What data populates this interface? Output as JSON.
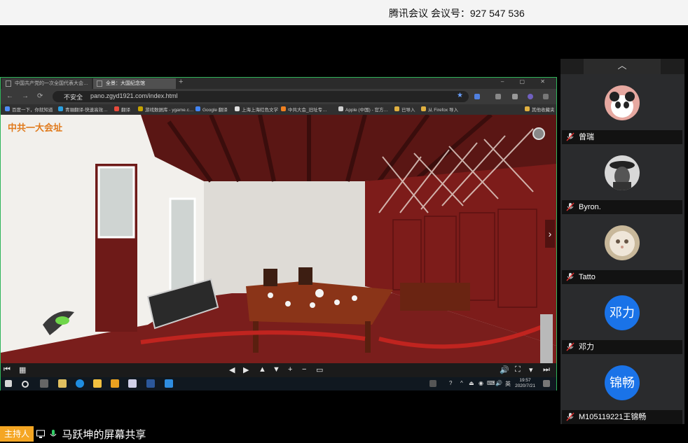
{
  "top_bar": {
    "meeting_info": "腾讯会议 会议号：927 547 536"
  },
  "browser": {
    "tabs": [
      {
        "label": "中国共产党的一次全国代表大会…"
      },
      {
        "label": "全景：大国纪念馆"
      }
    ],
    "new_tab": "+",
    "window_controls": "–  ▢  ✕",
    "nav": {
      "back": "←",
      "forward": "→",
      "reload": "⟳"
    },
    "address": {
      "security": "不安全",
      "url": "pano.zgyd1921.com/index.html",
      "star": "★"
    },
    "bookmarks": [
      {
        "label": "百度一下，你就知道",
        "color": "#4e8cf7"
      },
      {
        "label": "青骊翻译-快速高效…",
        "color": "#2aa0e0"
      },
      {
        "label": "翻译",
        "color": "#e84a3c"
      },
      {
        "label": "游戏数据库 - ygame.c…",
        "color": "#c5a300"
      },
      {
        "label": "Google 翻译",
        "color": "#4285f4"
      },
      {
        "label": "上海上海红色文学",
        "color": "#e0e0e0"
      },
      {
        "label": "中共大会_旧址专…",
        "color": "#f08020"
      },
      {
        "label": "Apple (中国) - 官方…",
        "color": "#cfcfcf"
      },
      {
        "label": "已导入",
        "color": "#e0b040"
      },
      {
        "label": "从 Firefox 导入",
        "color": "#e0b040"
      },
      {
        "label": "其他收藏夹",
        "color": "#e0b040"
      }
    ]
  },
  "scene": {
    "title": "中共一大会址",
    "next": "›"
  },
  "viewer_controls": {
    "left": [
      "⏮",
      "▦"
    ],
    "center": [
      "◀",
      "▶",
      "▲",
      "▼",
      "+",
      "−",
      "▭"
    ],
    "right": [
      "🔊",
      "⛶",
      "▾",
      "⏭"
    ]
  },
  "taskbar": {
    "clock_time": "19:57",
    "clock_date": "2020/7/21",
    "tray": [
      "?",
      "^",
      "⏏",
      "◉",
      "⌨",
      "🔊",
      "英"
    ]
  },
  "participants_panel": {
    "collapse": "︿",
    "participants": [
      {
        "name": "曾瑞",
        "avatar_type": "photo-panda",
        "avatar_text": ""
      },
      {
        "name": "Byron.",
        "avatar_type": "photo-man",
        "avatar_text": ""
      },
      {
        "name": "Tatto",
        "avatar_type": "photo-cat",
        "avatar_text": ""
      },
      {
        "name": "邓力",
        "avatar_type": "text",
        "avatar_text": "邓力"
      },
      {
        "name": "M105119221王锦畅",
        "avatar_type": "text",
        "avatar_text": "锦畅"
      }
    ]
  },
  "bottom": {
    "host_badge": "主持人",
    "sharer_text": "马跃坤的屏幕共享"
  }
}
